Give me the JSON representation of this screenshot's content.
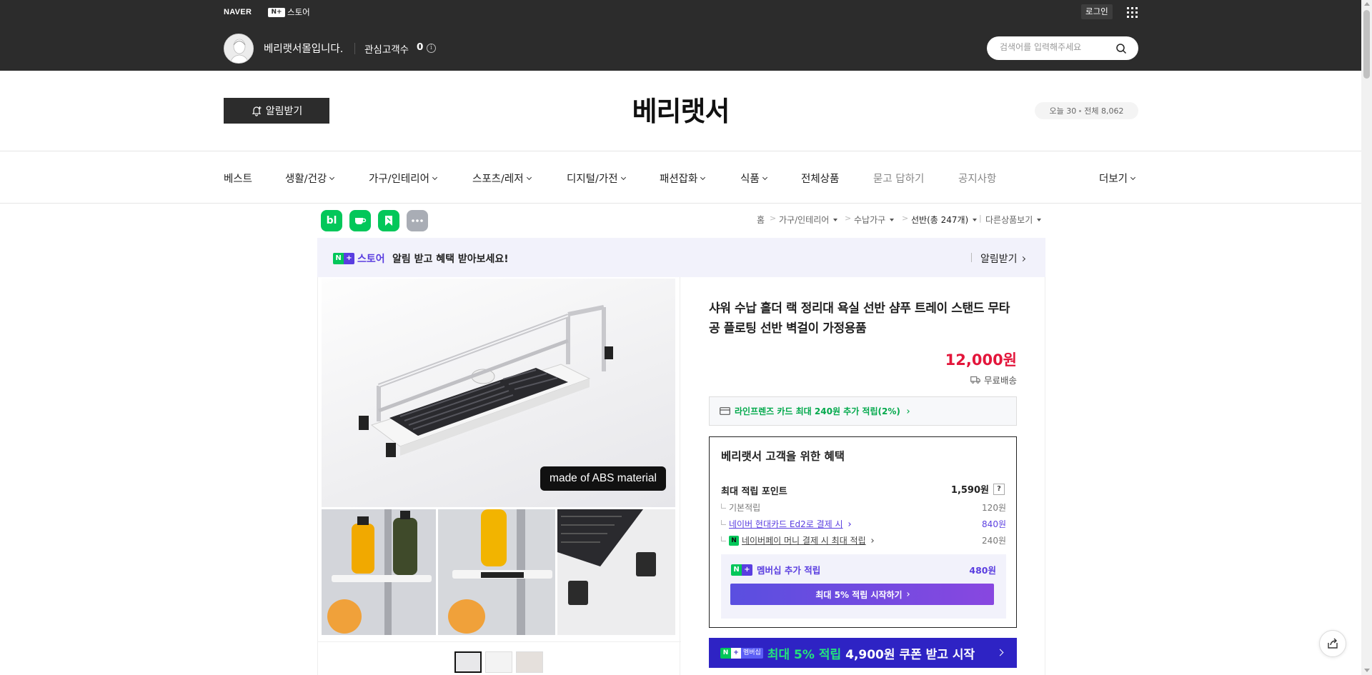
{
  "topbar": {
    "naver_logo": "NAVER",
    "store_badge": "N+",
    "store_label": "스토어",
    "login": "로그인",
    "store_name": "베리랫서몰입니다.",
    "fav_label": "관심고객수",
    "fav_count": "0",
    "search_placeholder": "검색어를 입력해주세요"
  },
  "header": {
    "alarm_button": "알림받기",
    "title": "베리랫서",
    "visit_today": "오늘 30",
    "visit_total": "전체 8,062"
  },
  "nav": {
    "items": [
      "베스트",
      "생활/건강",
      "가구/인테리어",
      "스포츠/레저",
      "디지털/가전",
      "패션잡화",
      "식품",
      "전체상품",
      "묻고 답하기",
      "공지사항"
    ],
    "more": "더보기"
  },
  "share": {
    "blog": "bl",
    "icons": [
      "blog-icon",
      "cafe-icon",
      "band-icon",
      "more-icon"
    ]
  },
  "breadcrumb": {
    "home": "홈",
    "cat1": "가구/인테리어",
    "cat2": "수납가구",
    "cat3": "선반(총 247개)",
    "other": "다른상품보기"
  },
  "promo": {
    "badge": "N+",
    "store": "스토어",
    "text": "알림 받고 혜택 받아보세요!",
    "action": "알림받기"
  },
  "product": {
    "image_tag": "made of ABS material",
    "title": "샤워 수납 홀더 랙 정리대 욕실 선반 샴푸 트레이 스탠드 무타공 플로팅 선반 벽걸이 가정용품",
    "price": "12,000원",
    "shipping": "무료배송",
    "card_offer": "라인프렌즈 카드 최대 240원 추가 적립(2%)"
  },
  "benefits": {
    "title": "베리랫서 고객을 위한 혜택",
    "max_label": "최대 적립 포인트",
    "max_value": "1,590원",
    "help": "?",
    "basic_label": "기본적립",
    "basic_value": "120원",
    "card_label": "네이버 현대카드 Ed2로 결제 시",
    "card_value": "840원",
    "pay_label": "네이버페이 머니 결제 시 최대 적립",
    "pay_value": "240원",
    "pay_badge": "N",
    "member_label": "멤버십 추가 적립",
    "member_value": "480원",
    "member_button": "최대 5% 적립 시작하기"
  },
  "membership_banner": {
    "badge_n": "N",
    "badge_p": "+",
    "badge_text": "멤버십",
    "highlight": "최대 5% 적립",
    "rest": "4,900원 쿠폰 받고 시작"
  },
  "colors": {
    "topbar": "#2c2c2c",
    "price": "#e3163b",
    "naver_green": "#03c75a",
    "plus_purple": "#5a3ee0",
    "banner_blue": "#2e23c4"
  }
}
